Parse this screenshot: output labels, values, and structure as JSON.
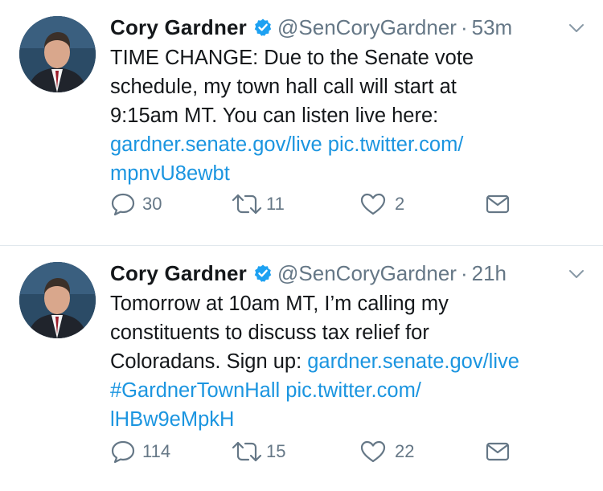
{
  "tweets": [
    {
      "name": "Cory Gardner",
      "handle": "@SenCoryGardner",
      "separator": "·",
      "time": "53m",
      "lines": [
        [
          {
            "t": "TIME CHANGE: Due to the Senate vote",
            "link": false
          }
        ],
        [
          {
            "t": "schedule, my town hall call will start at",
            "link": false
          }
        ],
        [
          {
            "t": "9:15am MT. You can listen live here:",
            "link": false
          }
        ],
        [
          {
            "t": "gardner.senate.gov/live pic.twitter.com/",
            "link": true
          }
        ],
        [
          {
            "t": "mpnvU8ewbt",
            "link": true
          }
        ]
      ],
      "replies": "30",
      "retweets": "11",
      "likes": "2"
    },
    {
      "name": "Cory Gardner",
      "handle": "@SenCoryGardner",
      "separator": "·",
      "time": "21h",
      "lines": [
        [
          {
            "t": "Tomorrow at 10am MT, I’m calling my",
            "link": false
          }
        ],
        [
          {
            "t": "constituents to discuss tax relief for",
            "link": false
          }
        ],
        [
          {
            "t": "Coloradans. Sign up: ",
            "link": false
          },
          {
            "t": "gardner.senate.gov/live",
            "link": true
          }
        ],
        [
          {
            "t": "#GardnerTownHall pic.twitter.com/",
            "link": true
          }
        ],
        [
          {
            "t": "lHBw9eMpkH",
            "link": true
          }
        ]
      ],
      "replies": "114",
      "retweets": "15",
      "likes": "22"
    }
  ],
  "colors": {
    "link": "#1b95e0",
    "muted": "#657786",
    "verified": "#1da1f2"
  },
  "icons": [
    "verified-badge-icon",
    "chevron-down-icon",
    "reply-icon",
    "retweet-icon",
    "like-icon",
    "direct-message-icon"
  ]
}
